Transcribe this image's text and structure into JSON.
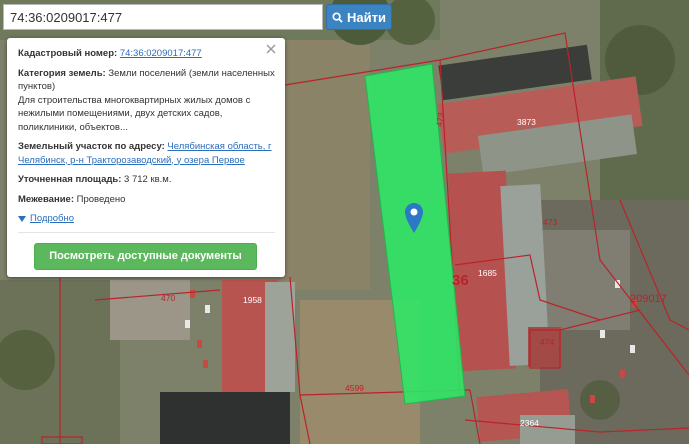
{
  "search": {
    "value": "74:36:0209017:477",
    "button_label": "Найти"
  },
  "panel": {
    "cadastral_label": "Кадастровый номер:",
    "cadastral_value": "74:36:0209017:477",
    "category_label": "Категория земель:",
    "category_value": "Земли поселений (земли населенных пунктов)",
    "purpose_value": "Для строительства многоквартирных жилых домов с нежилыми помещениями, двух детских садов, поликлиники, объектов...",
    "address_label": "Земельный участок по адресу:",
    "address_value": "Челябинская область, г Челябинск, р-н Тракторозаводский, у озера Первое",
    "area_label": "Уточненная площадь:",
    "area_value": "3 712 кв.м.",
    "survey_label": "Межевание:",
    "survey_value": "Проведено",
    "more_label": "Подробно",
    "docs_button": "Посмотреть доступные документы"
  },
  "map_labels": {
    "parcel_473_top": "473",
    "building_3873": "3873",
    "label_473": "473",
    "label_36": "36",
    "building_1685": "1685",
    "label_470": "470",
    "building_1958": "1958",
    "label_474": "474",
    "block_209017": "209017",
    "label_4599": "4599",
    "building_2364": "2364"
  },
  "colors": {
    "parcel_highlight": "#2ee866",
    "boundary_line": "#b9232a",
    "search_button": "#3c83c2",
    "docs_button": "#5cb85c",
    "link": "#2a6ebd",
    "pin": "#2c77c6"
  },
  "icons": {
    "search": "search-icon",
    "close": "close-icon",
    "chevron": "chevron-down-icon",
    "pin": "map-pin-icon"
  }
}
